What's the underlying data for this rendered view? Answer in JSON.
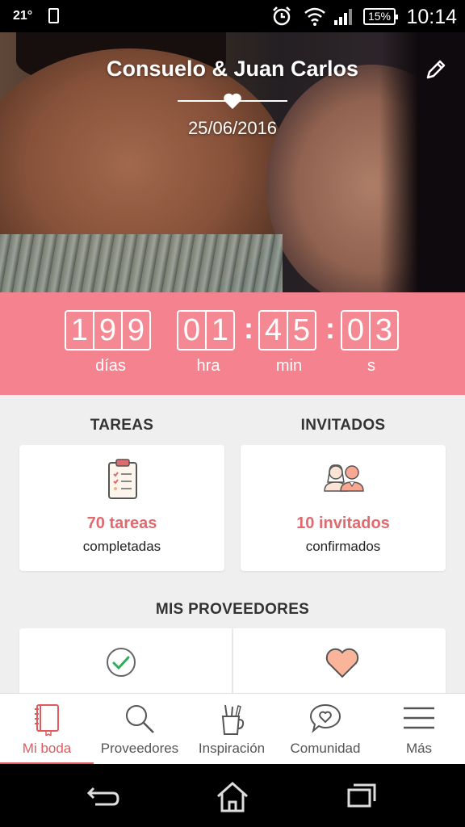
{
  "status_bar": {
    "temperature": "21°",
    "battery": "15%",
    "time": "10:14"
  },
  "hero": {
    "couple_names": "Consuelo & Juan Carlos",
    "wedding_date": "25/06/2016"
  },
  "countdown": {
    "days_digits": [
      "1",
      "9",
      "9"
    ],
    "hours_digits": [
      "0",
      "1"
    ],
    "minutes_digits": [
      "4",
      "5"
    ],
    "seconds_digits": [
      "0",
      "3"
    ],
    "separator": ":",
    "labels": {
      "days": "días",
      "hours": "hra",
      "minutes": "min",
      "seconds": "s"
    }
  },
  "tareas": {
    "title": "TAREAS",
    "stat": "70 tareas",
    "sub": "completadas"
  },
  "invitados": {
    "title": "INVITADOS",
    "stat": "10 invitados",
    "sub": "confirmados"
  },
  "proveedores": {
    "title": "MIS PROVEEDORES"
  },
  "tabs": [
    {
      "label": "Mi boda",
      "icon": "notebook-icon",
      "active": true
    },
    {
      "label": "Proveedores",
      "icon": "search-icon"
    },
    {
      "label": "Inspiración",
      "icon": "pencil-cup-icon"
    },
    {
      "label": "Comunidad",
      "icon": "chat-heart-icon"
    },
    {
      "label": "Más",
      "icon": "menu-icon"
    }
  ],
  "colors": {
    "accent": "#f4838f",
    "accent_text": "#e05a5e"
  }
}
